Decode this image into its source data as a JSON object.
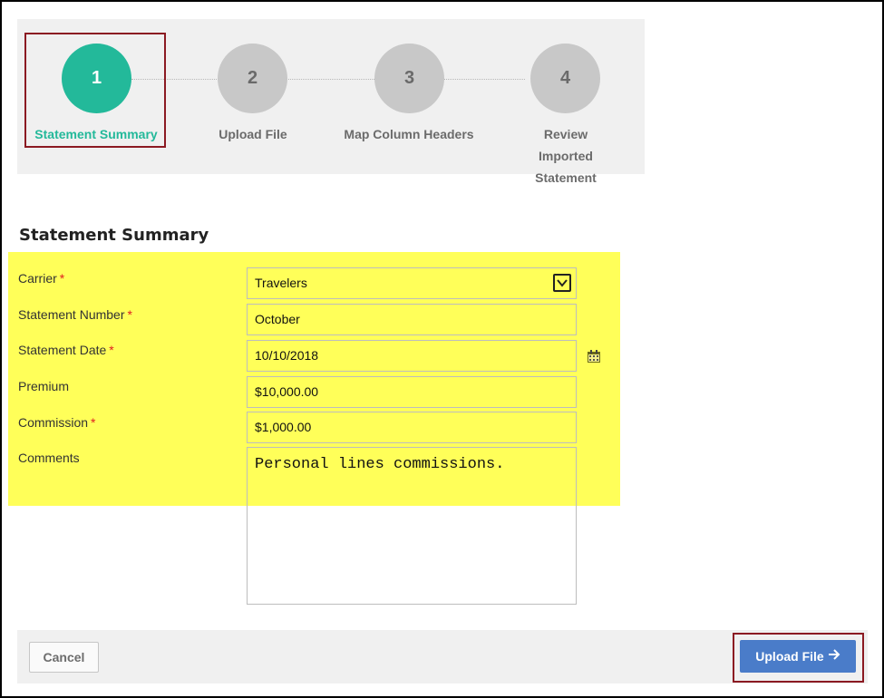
{
  "wizard": {
    "steps": [
      {
        "number": "1",
        "label": "Statement Summary",
        "active": true
      },
      {
        "number": "2",
        "label": "Upload File",
        "active": false
      },
      {
        "number": "3",
        "label": "Map Column Headers",
        "active": false
      },
      {
        "number": "4",
        "label": "Review Imported Statement",
        "active": false
      }
    ]
  },
  "section": {
    "title": "Statement Summary"
  },
  "form": {
    "carrier": {
      "label": "Carrier",
      "required_mark": "*",
      "value": "Travelers",
      "icon": "chevron-down-icon"
    },
    "statement_number": {
      "label": "Statement Number",
      "required_mark": "*",
      "value": "October"
    },
    "statement_date": {
      "label": "Statement Date",
      "required_mark": "*",
      "value": "10/10/2018",
      "icon": "calendar-icon"
    },
    "premium": {
      "label": "Premium",
      "value": "$10,000.00"
    },
    "commission": {
      "label": "Commission",
      "required_mark": "*",
      "value": "$1,000.00"
    },
    "comments": {
      "label": "Comments",
      "value": "Personal lines commissions."
    }
  },
  "footer": {
    "cancel_label": "Cancel",
    "upload_label": "Upload File",
    "upload_icon": "arrow-right-icon"
  },
  "colors": {
    "active_step": "#23b99a",
    "inactive_step": "#c8c8c8",
    "highlight": "#ffff59",
    "annotation_border": "#8b1a22",
    "primary_button": "#4a7cc9",
    "required": "#e02020"
  }
}
